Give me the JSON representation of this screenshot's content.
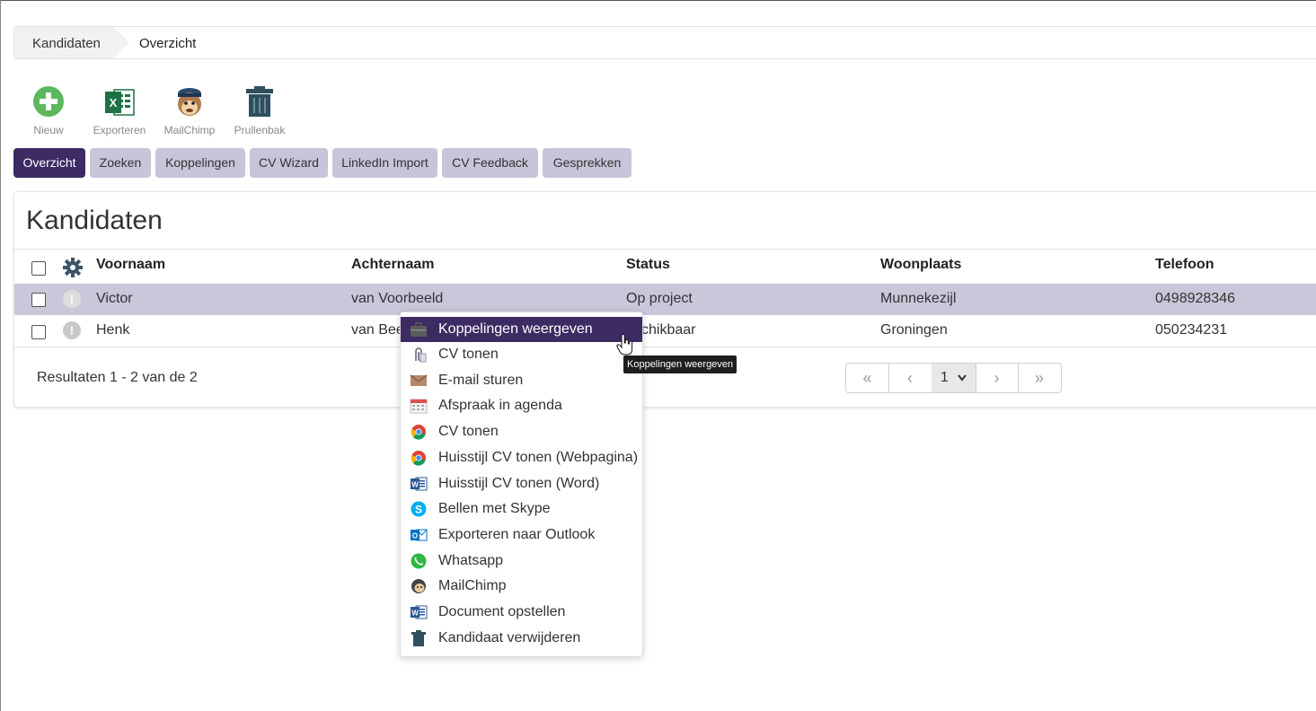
{
  "breadcrumb": {
    "root": "Kandidaten",
    "current": "Overzicht"
  },
  "toolbar": [
    {
      "label": "Nieuw",
      "icon": "plus-circle-icon"
    },
    {
      "label": "Exporteren",
      "icon": "excel-icon"
    },
    {
      "label": "MailChimp",
      "icon": "mailchimp-icon"
    },
    {
      "label": "Prullenbak",
      "icon": "trash-icon"
    }
  ],
  "tabs": [
    {
      "label": "Overzicht",
      "active": true
    },
    {
      "label": "Zoeken"
    },
    {
      "label": "Koppelingen"
    },
    {
      "label": "CV Wizard"
    },
    {
      "label": "LinkedIn Import"
    },
    {
      "label": "CV Feedback"
    },
    {
      "label": "Gesprekken"
    }
  ],
  "panel": {
    "title": "Kandidaten",
    "columns": [
      "Voornaam",
      "Achternaam",
      "Status",
      "Woonplaats",
      "Telefoon"
    ],
    "rows": [
      {
        "voornaam": "Victor",
        "achternaam": "van Voorbeeld",
        "status": "Op project",
        "woonplaats": "Munnekezijl",
        "telefoon": "0498928346",
        "selected": true
      },
      {
        "voornaam": "Henk",
        "achternaam": "van Bee",
        "status": "schikbaar",
        "woonplaats": "Groningen",
        "telefoon": "050234231"
      }
    ],
    "results": "Resultaten 1 - 2 van de 2",
    "pager": {
      "first": "«",
      "prev": "‹",
      "page": "1",
      "next": "›",
      "last": "»"
    }
  },
  "context_menu": {
    "items": [
      {
        "label": "Koppelingen weergeven",
        "icon": "briefcase-icon",
        "highlighted": true
      },
      {
        "label": "CV tonen",
        "icon": "paperclip-icon"
      },
      {
        "label": "E-mail sturen",
        "icon": "envelope-icon"
      },
      {
        "label": "Afspraak in agenda",
        "icon": "calendar-icon"
      },
      {
        "label": "CV tonen",
        "icon": "chrome-icon"
      },
      {
        "label": "Huisstijl CV tonen (Webpagina)",
        "icon": "chrome-icon"
      },
      {
        "label": "Huisstijl CV tonen (Word)",
        "icon": "word-icon"
      },
      {
        "label": "Bellen met Skype",
        "icon": "skype-icon"
      },
      {
        "label": "Exporteren naar Outlook",
        "icon": "outlook-icon"
      },
      {
        "label": "Whatsapp",
        "icon": "whatsapp-icon"
      },
      {
        "label": "MailChimp",
        "icon": "mailchimp-icon"
      },
      {
        "label": "Document opstellen",
        "icon": "word-icon"
      },
      {
        "label": "Kandidaat verwijderen",
        "icon": "trash-icon"
      }
    ],
    "tooltip": "Koppelingen weergeven"
  },
  "colors": {
    "accent": "#3d2b63",
    "tab": "#c9c4d9",
    "row_selected": "#cbc6da"
  }
}
